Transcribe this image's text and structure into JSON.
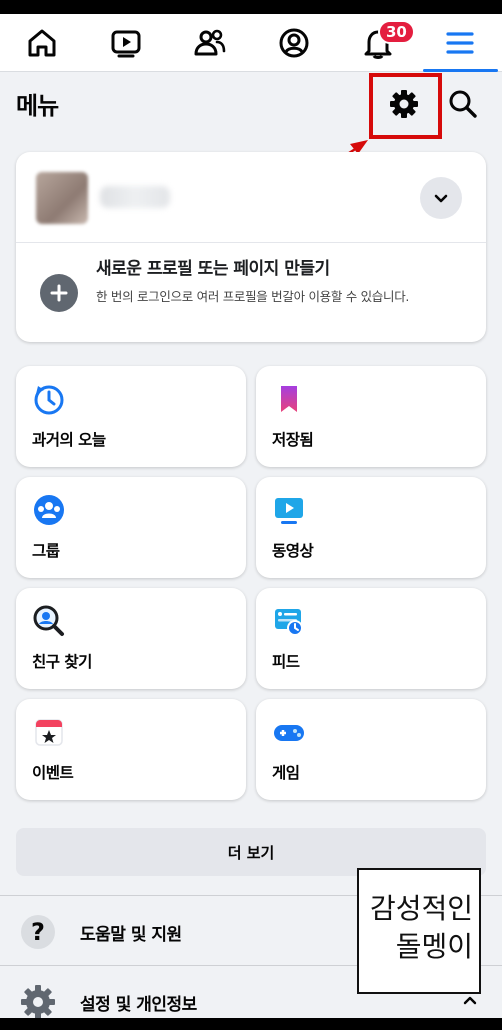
{
  "colors": {
    "accent": "#1877f2",
    "badge": "#e41e3f",
    "highlight": "#d60a0a"
  },
  "topnav": {
    "items": [
      {
        "icon": "home-icon"
      },
      {
        "icon": "video-icon"
      },
      {
        "icon": "friends-icon"
      },
      {
        "icon": "profile-icon"
      },
      {
        "icon": "bell-icon",
        "badge": "30"
      },
      {
        "icon": "menu-icon",
        "active": true
      }
    ]
  },
  "header": {
    "title": "메뉴"
  },
  "profile_card": {
    "new_profile_title": "새로운 프로필 또는 페이지 만들기",
    "new_profile_desc": "한 번의 로그인으로 여러 프로필을 번갈아 이용할 수 있습니다."
  },
  "shortcuts": [
    {
      "label": "과거의 오늘",
      "icon": "memories-icon"
    },
    {
      "label": "저장됨",
      "icon": "bookmark-icon"
    },
    {
      "label": "그룹",
      "icon": "groups-icon"
    },
    {
      "label": "동영상",
      "icon": "video-tile-icon"
    },
    {
      "label": "친구 찾기",
      "icon": "find-friends-icon"
    },
    {
      "label": "피드",
      "icon": "feed-icon"
    },
    {
      "label": "이벤트",
      "icon": "calendar-icon"
    },
    {
      "label": "게임",
      "icon": "gamepad-icon"
    }
  ],
  "more_button": "더 보기",
  "sections": [
    {
      "label": "도움말 및 지원",
      "icon": "help-icon"
    },
    {
      "label": "설정 및 개인정보",
      "icon": "settings-icon"
    }
  ],
  "watermark": {
    "line1": "감성적인",
    "line2": "돌멩이"
  }
}
